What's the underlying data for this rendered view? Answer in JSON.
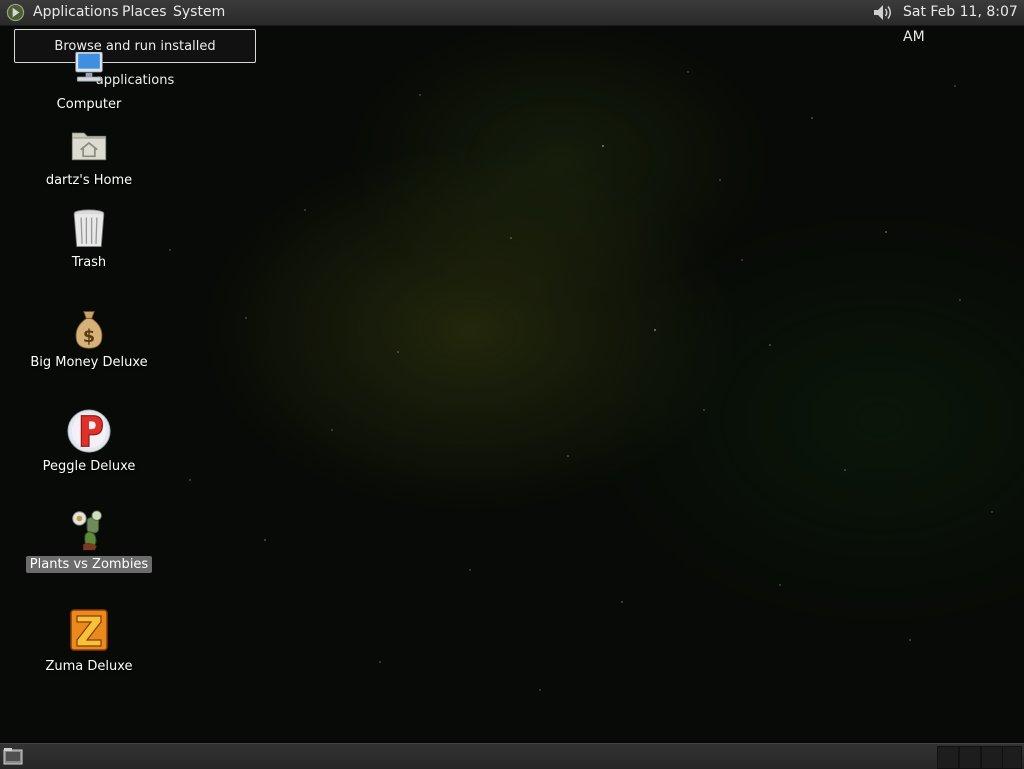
{
  "top_panel": {
    "menus": {
      "applications": "Applications",
      "places": "Places",
      "system": "System"
    },
    "clock": "Sat Feb 11,  8:07 AM",
    "icons": {
      "applications": "gnome-foot-icon",
      "volume": "speaker-icon"
    }
  },
  "tooltip": {
    "text": "Browse and run installed applications"
  },
  "desktop": {
    "icons": [
      {
        "label": "Computer",
        "icon": "computer-icon"
      },
      {
        "label": "dartz's Home",
        "icon": "home-folder-icon"
      },
      {
        "label": "Trash",
        "icon": "trash-icon"
      },
      {
        "label": "Big Money Deluxe",
        "icon": "money-bag-icon"
      },
      {
        "label": "Peggle Deluxe",
        "icon": "peggle-icon"
      },
      {
        "label": "Plants vs Zombies",
        "icon": "plants-vs-zombies-icon",
        "selected": true
      },
      {
        "label": "Zuma Deluxe",
        "icon": "zuma-icon"
      }
    ]
  },
  "bottom_panel": {
    "icons": {
      "show_desktop": "show-desktop-icon"
    }
  }
}
